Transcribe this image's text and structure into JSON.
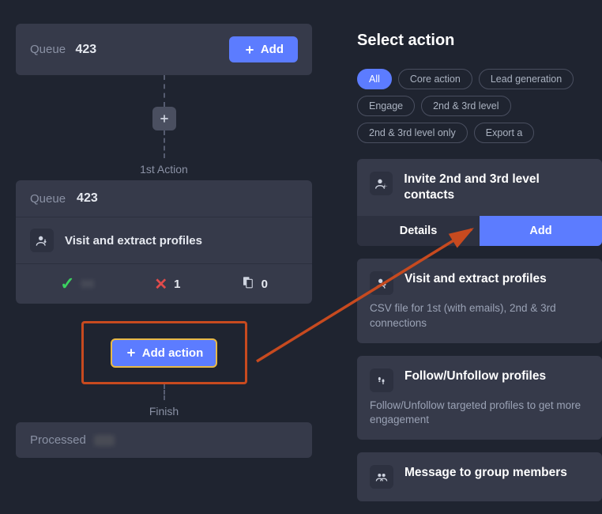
{
  "left": {
    "queue1": {
      "label": "Queue",
      "count": "423"
    },
    "add_btn": "Add",
    "first_action_label": "1st Action",
    "queue2": {
      "label": "Queue",
      "count": "423"
    },
    "action_title": "Visit and extract profiles",
    "stats": {
      "success_hidden": "00",
      "fail": "1",
      "docs": "0"
    },
    "add_action_btn": "Add action",
    "finish_label": "Finish",
    "processed_label": "Processed"
  },
  "right": {
    "title": "Select action",
    "filters": [
      "All",
      "Core action",
      "Lead generation",
      "Engage",
      "2nd & 3rd level",
      "2nd & 3rd level only",
      "Export a"
    ],
    "active_filter": 0,
    "items": [
      {
        "title": "Invite 2nd and 3rd level contacts",
        "details_btn": "Details",
        "add_btn": "Add"
      },
      {
        "title": "Visit and extract profiles",
        "desc": "CSV file for 1st (with emails), 2nd & 3rd connections"
      },
      {
        "title": "Follow/Unfollow profiles",
        "desc": "Follow/Unfollow targeted profiles to get more engagement"
      },
      {
        "title": "Message to group members"
      }
    ]
  }
}
